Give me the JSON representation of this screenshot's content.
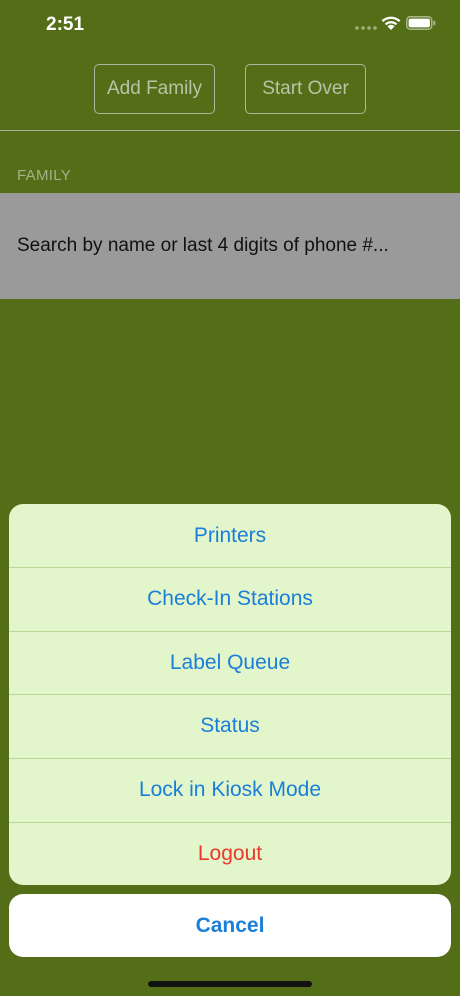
{
  "status_bar": {
    "time": "2:51",
    "icons": [
      "signal-icon",
      "wifi-icon",
      "battery-icon"
    ]
  },
  "header": {
    "add_family_label": "Add Family",
    "start_over_label": "Start Over"
  },
  "family": {
    "section_label": "FAMILY",
    "search_placeholder": "Search by name or last 4 digits of phone #..."
  },
  "action_sheet": {
    "items": [
      {
        "label": "Printers"
      },
      {
        "label": "Check-In Stations"
      },
      {
        "label": "Label Queue"
      },
      {
        "label": "Status"
      },
      {
        "label": "Lock in Kiosk Mode"
      },
      {
        "label": "Logout"
      }
    ],
    "cancel_label": "Cancel"
  },
  "colors": {
    "background": "#546e17",
    "sheet_background": "#e2f5cb",
    "action_blue": "#1a7fd8",
    "destructive_red": "#e8392b",
    "search_row": "#9a9a9a"
  }
}
